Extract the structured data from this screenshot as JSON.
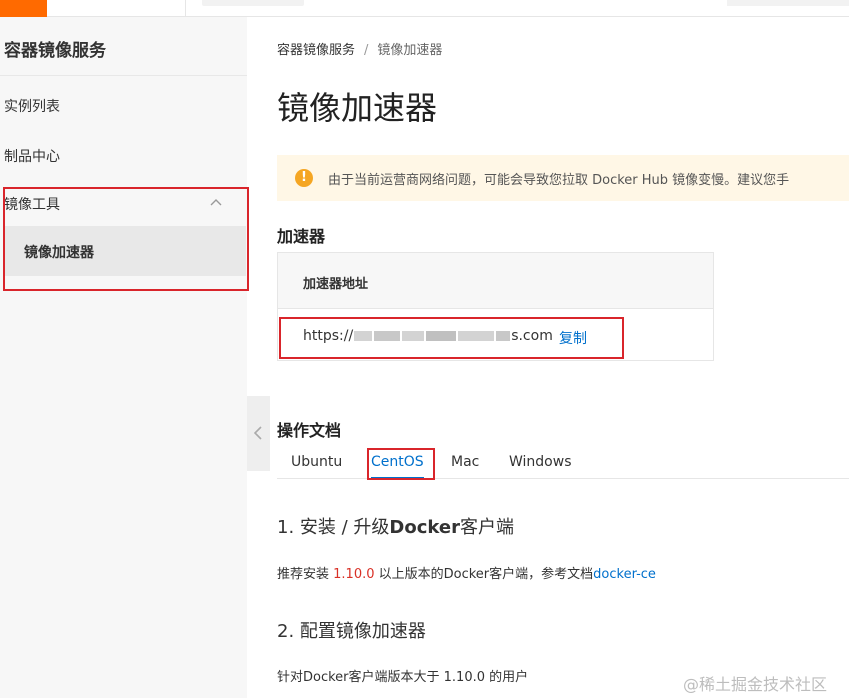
{
  "sidebar": {
    "title": "容器镜像服务",
    "items": [
      {
        "label": "实例列表"
      },
      {
        "label": "制品中心"
      }
    ],
    "group": {
      "label": "镜像工具",
      "active_item": "镜像加速器"
    }
  },
  "breadcrumb": {
    "root": "容器镜像服务",
    "separator": "/",
    "current": "镜像加速器"
  },
  "page": {
    "title": "镜像加速器"
  },
  "notice": {
    "icon": "!",
    "text": "由于当前运营商网络问题，可能会导致您拉取 Docker Hub 镜像变慢。建议您手"
  },
  "accelerator": {
    "heading": "加速器",
    "column_header": "加速器地址",
    "url_prefix": "https://",
    "url_suffix": "s.com",
    "copy_label": "复制"
  },
  "docs": {
    "heading": "操作文档",
    "tabs": [
      {
        "label": "Ubuntu",
        "active": false
      },
      {
        "label": "CentOS",
        "active": true
      },
      {
        "label": "Mac",
        "active": false
      },
      {
        "label": "Windows",
        "active": false
      }
    ],
    "step1": {
      "num": "1. ",
      "pre": "安装 / 升级",
      "bold": "Docker",
      "post": "客户端"
    },
    "step1_text": {
      "pre": "推荐安装 ",
      "version": "1.10.0",
      "mid": " 以上版本的Docker客户端，参考文档",
      "link": "docker-ce"
    },
    "step2": {
      "title": "2. 配置镜像加速器"
    },
    "step2_text": "针对Docker客户端版本大于 1.10.0 的用户"
  },
  "watermark": "@稀土掘金技术社区",
  "colors": {
    "accent": "#0070cc",
    "brand": "#ff6a00",
    "annotation_red": "#d9252b",
    "version_red": "#d93026",
    "notice_bg": "#fff7e6"
  }
}
